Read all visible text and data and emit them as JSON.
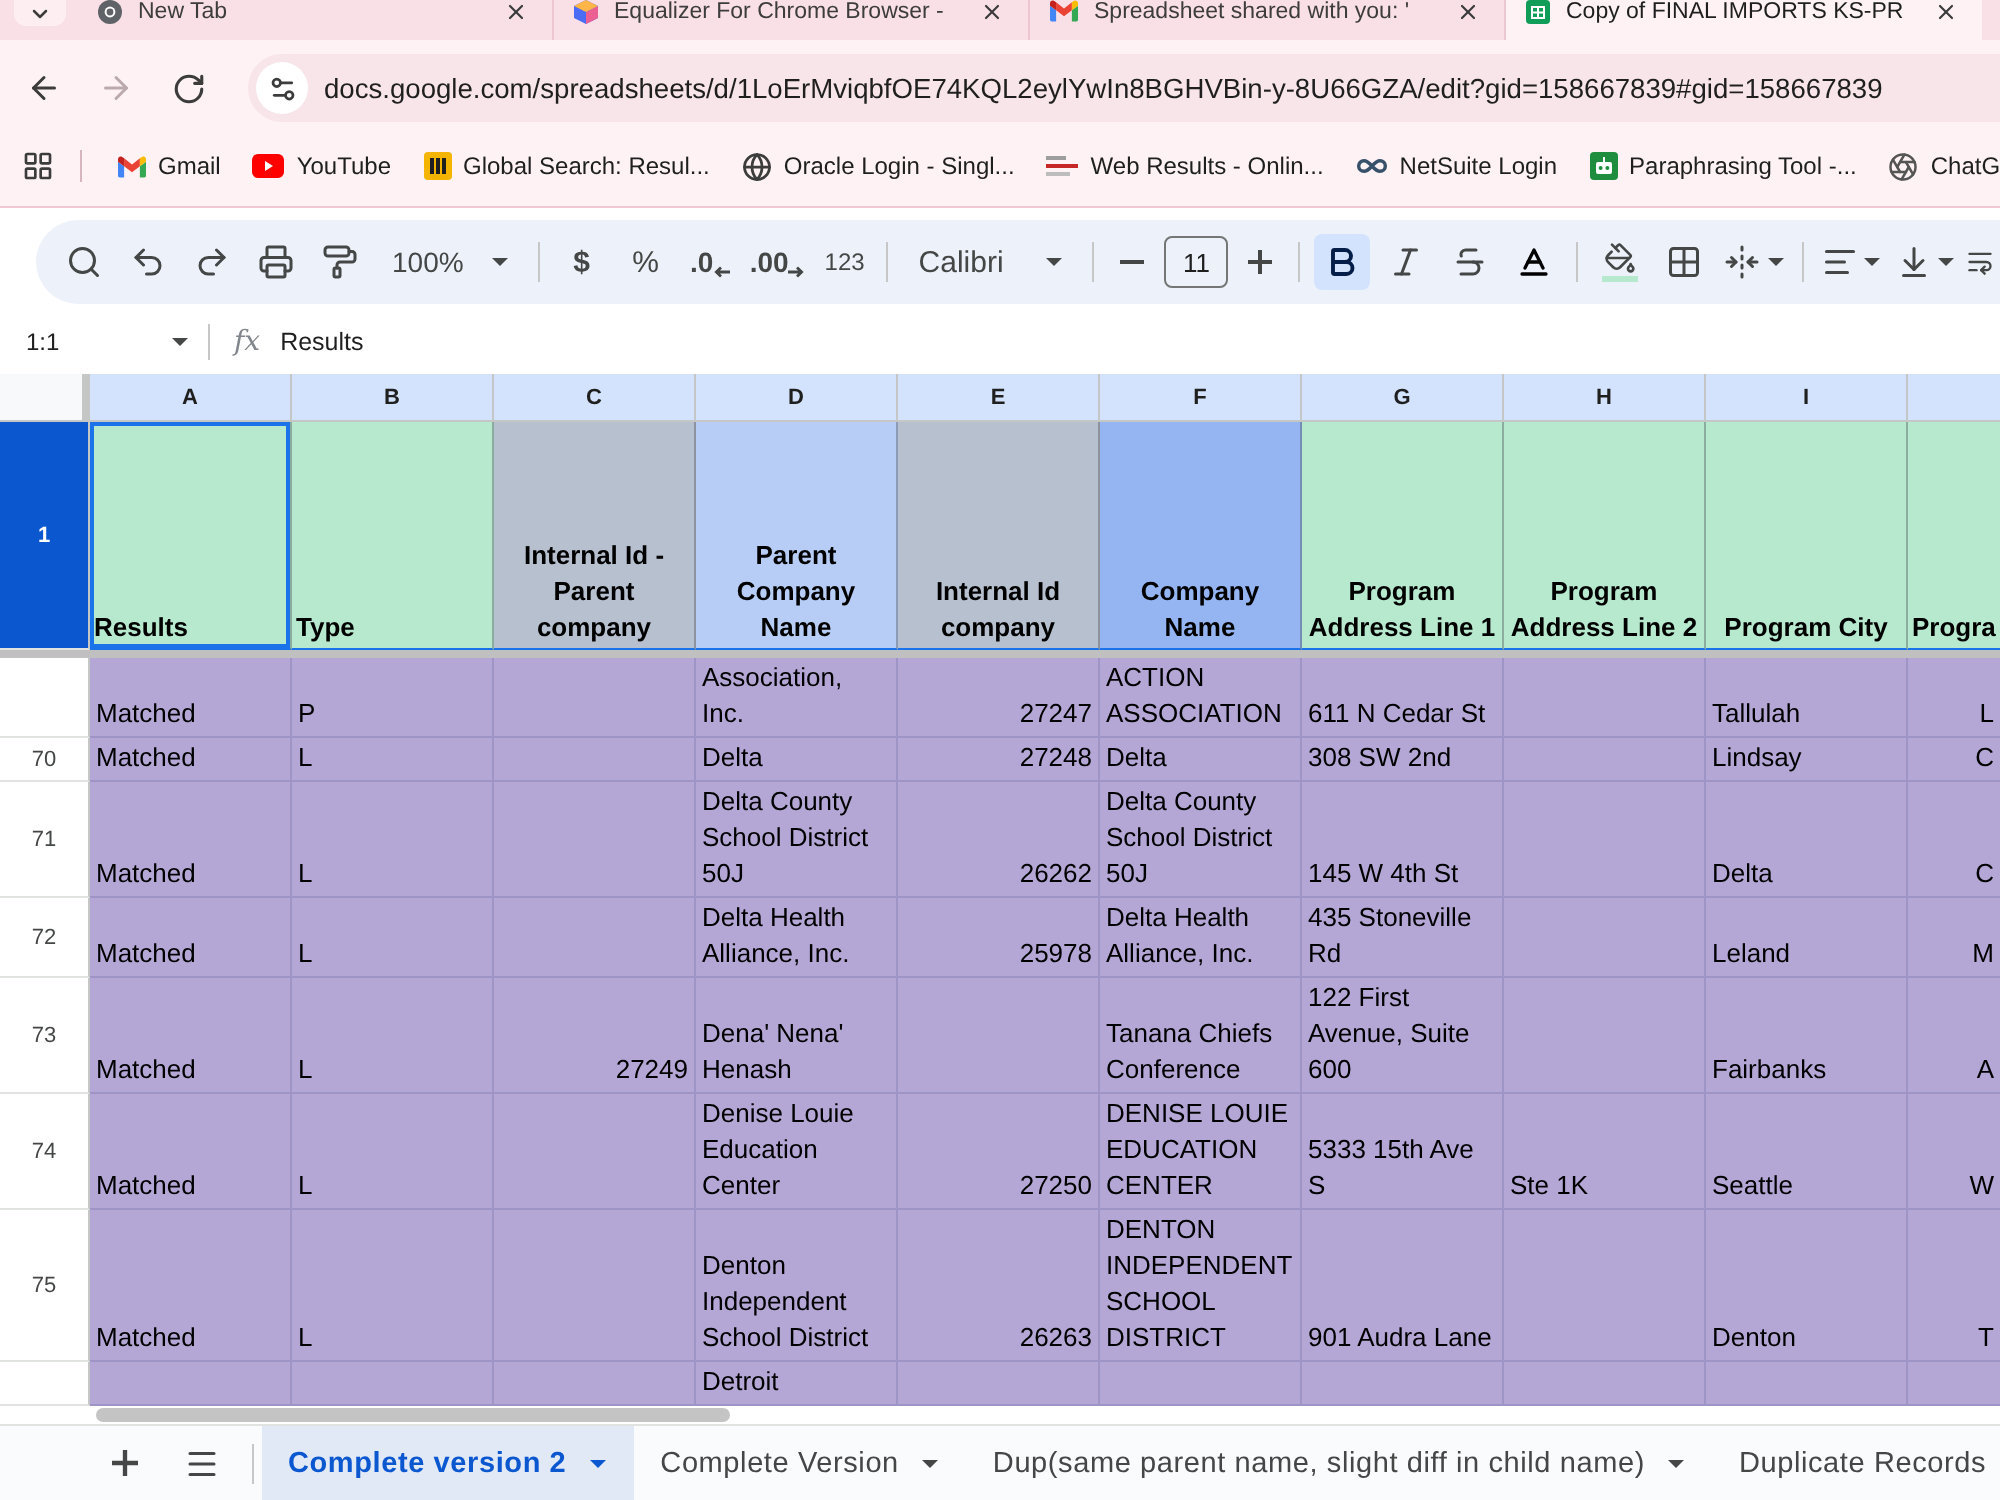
{
  "browser": {
    "tabs": [
      {
        "title": "New Tab",
        "selected": false
      },
      {
        "title": "Equalizer For Chrome Browser -",
        "selected": false
      },
      {
        "title": "Spreadsheet shared with you: '",
        "selected": false
      },
      {
        "title": "Copy of FINAL IMPORTS KS-PR",
        "selected": true
      }
    ],
    "navigation": {
      "back_disabled": false,
      "forward_disabled": true
    },
    "address": "docs.google.com/spreadsheets/d/1LoErMviqbfOE74KQL2eylYwIn8BGHVBin-y-8U66GZA/edit?gid=158667839#gid=158667839",
    "bookmarks": [
      {
        "label": "Gmail"
      },
      {
        "label": "YouTube"
      },
      {
        "label": "Global Search: Resul..."
      },
      {
        "label": "Oracle Login - Singl..."
      },
      {
        "label": "Web Results - Onlin..."
      },
      {
        "label": "NetSuite Login"
      },
      {
        "label": "Paraphrasing Tool -..."
      },
      {
        "label": "ChatG"
      }
    ]
  },
  "toolbar": {
    "zoom": "100%",
    "currency": "$",
    "percent": "%",
    "decrease_decimal": ".0",
    "increase_decimal": ".00",
    "number_format": "123",
    "font": "Calibri",
    "font_size": "11",
    "bold": true,
    "italic": false,
    "strikethrough": false
  },
  "formula_bar": {
    "name_box": "1:1",
    "fx": "fx",
    "content": "Results"
  },
  "sheet": {
    "columns": [
      {
        "letter": "A",
        "heading": "Results",
        "color": "#b7e9cf"
      },
      {
        "letter": "B",
        "heading": "Type",
        "color": "#b7e9cf"
      },
      {
        "letter": "C",
        "heading": "Internal Id - Parent company",
        "color": "#b7c0cf"
      },
      {
        "letter": "D",
        "heading": "Parent Company Name",
        "color": "#b7cdf5"
      },
      {
        "letter": "E",
        "heading": "Internal Id company",
        "color": "#b7c0cf"
      },
      {
        "letter": "F",
        "heading": "Company Name",
        "color": "#94b5f2"
      },
      {
        "letter": "G",
        "heading": "Program Address Line 1",
        "color": "#b7e9cf"
      },
      {
        "letter": "H",
        "heading": "Program Address Line 2",
        "color": "#b7e9cf"
      },
      {
        "letter": "I",
        "heading": "Program City",
        "color": "#b7e9cf"
      },
      {
        "heading": "Progra",
        "color": "#b7e9cf"
      }
    ],
    "header_row": {
      "number": "1",
      "selected": true
    },
    "rows": [
      {
        "selected": false,
        "cells": [
          "Matched",
          "P",
          null,
          "Association, Inc.",
          "27247",
          "ACTION ASSOCIATION",
          "611 N Cedar St",
          null,
          "Tallulah",
          "L"
        ]
      },
      {
        "number": "70",
        "selected": false,
        "cells": [
          "Matched",
          "L",
          null,
          "Delta",
          "27248",
          "Delta",
          "308 SW 2nd",
          null,
          "Lindsay",
          "C"
        ]
      },
      {
        "number": "71",
        "selected": false,
        "cells": [
          "Matched",
          "L",
          null,
          "Delta County School District 50J",
          "26262",
          "Delta County School District 50J",
          "145 W 4th St",
          null,
          "Delta",
          "C"
        ]
      },
      {
        "number": "72",
        "selected": false,
        "cells": [
          "Matched",
          "L",
          null,
          "Delta Health Alliance, Inc.",
          "25978",
          "Delta Health Alliance, Inc.",
          "435 Stoneville Rd",
          null,
          "Leland",
          "M"
        ]
      },
      {
        "number": "73",
        "selected": false,
        "cells": [
          "Matched",
          "L",
          "27249",
          "Dena' Nena' Henash",
          null,
          "Tanana Chiefs Conference",
          "122 First Avenue, Suite 600",
          null,
          "Fairbanks",
          "A"
        ]
      },
      {
        "number": "74",
        "selected": false,
        "cells": [
          "Matched",
          "L",
          null,
          "Denise Louie Education Center",
          "27250",
          "DENISE LOUIE EDUCATION CENTER",
          "5333 15th Ave S",
          "Ste 1K",
          "Seattle",
          "W"
        ]
      },
      {
        "number": "75",
        "selected": false,
        "cells": [
          "Matched",
          "L",
          null,
          "Denton Independent School District",
          "26263",
          "DENTON INDEPENDENT SCHOOL DISTRICT",
          "901 Audra Lane",
          null,
          "Denton",
          "T"
        ]
      },
      {
        "selected": false,
        "cells": [
          null,
          null,
          null,
          "Detroit",
          null,
          null,
          null,
          null,
          null,
          null
        ]
      }
    ]
  },
  "sheet_tabs": [
    {
      "label": "Complete version 2",
      "selected": true
    },
    {
      "label": "Complete Version",
      "selected": false
    },
    {
      "label": "Dup(same parent name, slight diff in child name)",
      "selected": false
    },
    {
      "label": "Duplicate Records",
      "selected": false
    }
  ]
}
